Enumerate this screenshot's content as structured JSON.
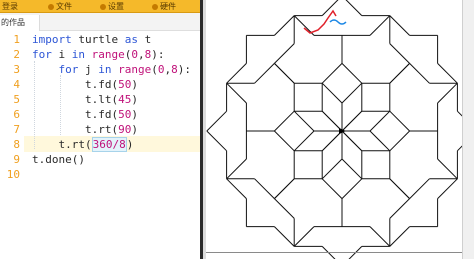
{
  "toolbar": {
    "items": [
      {
        "label": "登录",
        "icon": "user-icon"
      },
      {
        "label": "文件",
        "icon": "folder-icon"
      },
      {
        "label": "设置",
        "icon": "gear-icon"
      },
      {
        "label": "硬件",
        "icon": "chip-icon"
      }
    ],
    "accent_color": "#f5b92a"
  },
  "tabs": [
    {
      "label": "的作品",
      "active": true
    }
  ],
  "editor": {
    "line_numbers": [
      "1",
      "2",
      "3",
      "4",
      "5",
      "6",
      "7",
      "8",
      "9",
      "10"
    ],
    "active_line": "8",
    "code": [
      "import turtle as t",
      "for i in range(0,8):",
      "    for j in range(0,8):",
      "        t.fd(50)",
      "        t.lt(45)",
      "        t.fd(50)",
      "        t.rt(90)",
      "    t.rt(360/8)",
      "t.done()",
      ""
    ],
    "keyword_color": "#2d56d6",
    "builtin_color": "#c0127a"
  },
  "canvas": {
    "pattern": "turtle-star-polygon",
    "stroke_color": "#111111",
    "annotation_colors": [
      "#e0202a",
      "#1e88e5"
    ]
  }
}
